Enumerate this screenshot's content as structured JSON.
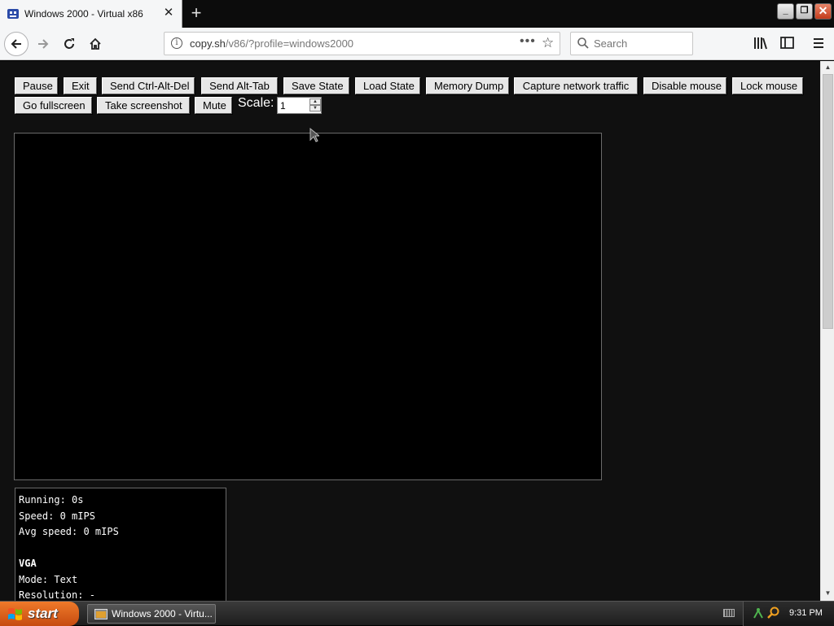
{
  "browser": {
    "tab_title": "Windows 2000 - Virtual x86",
    "url_host": "copy.sh",
    "url_path": "/v86/?profile=windows2000",
    "search_placeholder": "Search",
    "url_more": "•••"
  },
  "toolbar": {
    "row1": [
      "Pause",
      "Exit",
      "Send Ctrl-Alt-Del",
      "Send Alt-Tab",
      "Save State",
      "Load State",
      "Memory Dump",
      "Capture network traffic",
      "Disable mouse",
      "Lock mouse"
    ],
    "row2": [
      "Go fullscreen",
      "Take screenshot",
      "Mute"
    ],
    "scale_label": "Scale:",
    "scale_value": "1"
  },
  "stats": {
    "running": "Running: 0s",
    "speed": "Speed: 0 mIPS",
    "avg_speed": "Avg speed: 0 mIPS",
    "vga_header": "VGA",
    "mode": "Mode: Text",
    "resolution": "Resolution: -"
  },
  "taskbar": {
    "start_label": "start",
    "task_label": "Windows 2000 - Virtu...",
    "clock": "9:31 PM"
  },
  "colors": {
    "page_bg": "#101010",
    "start_orange": "#e0631f",
    "text_white": "#ffffff"
  }
}
